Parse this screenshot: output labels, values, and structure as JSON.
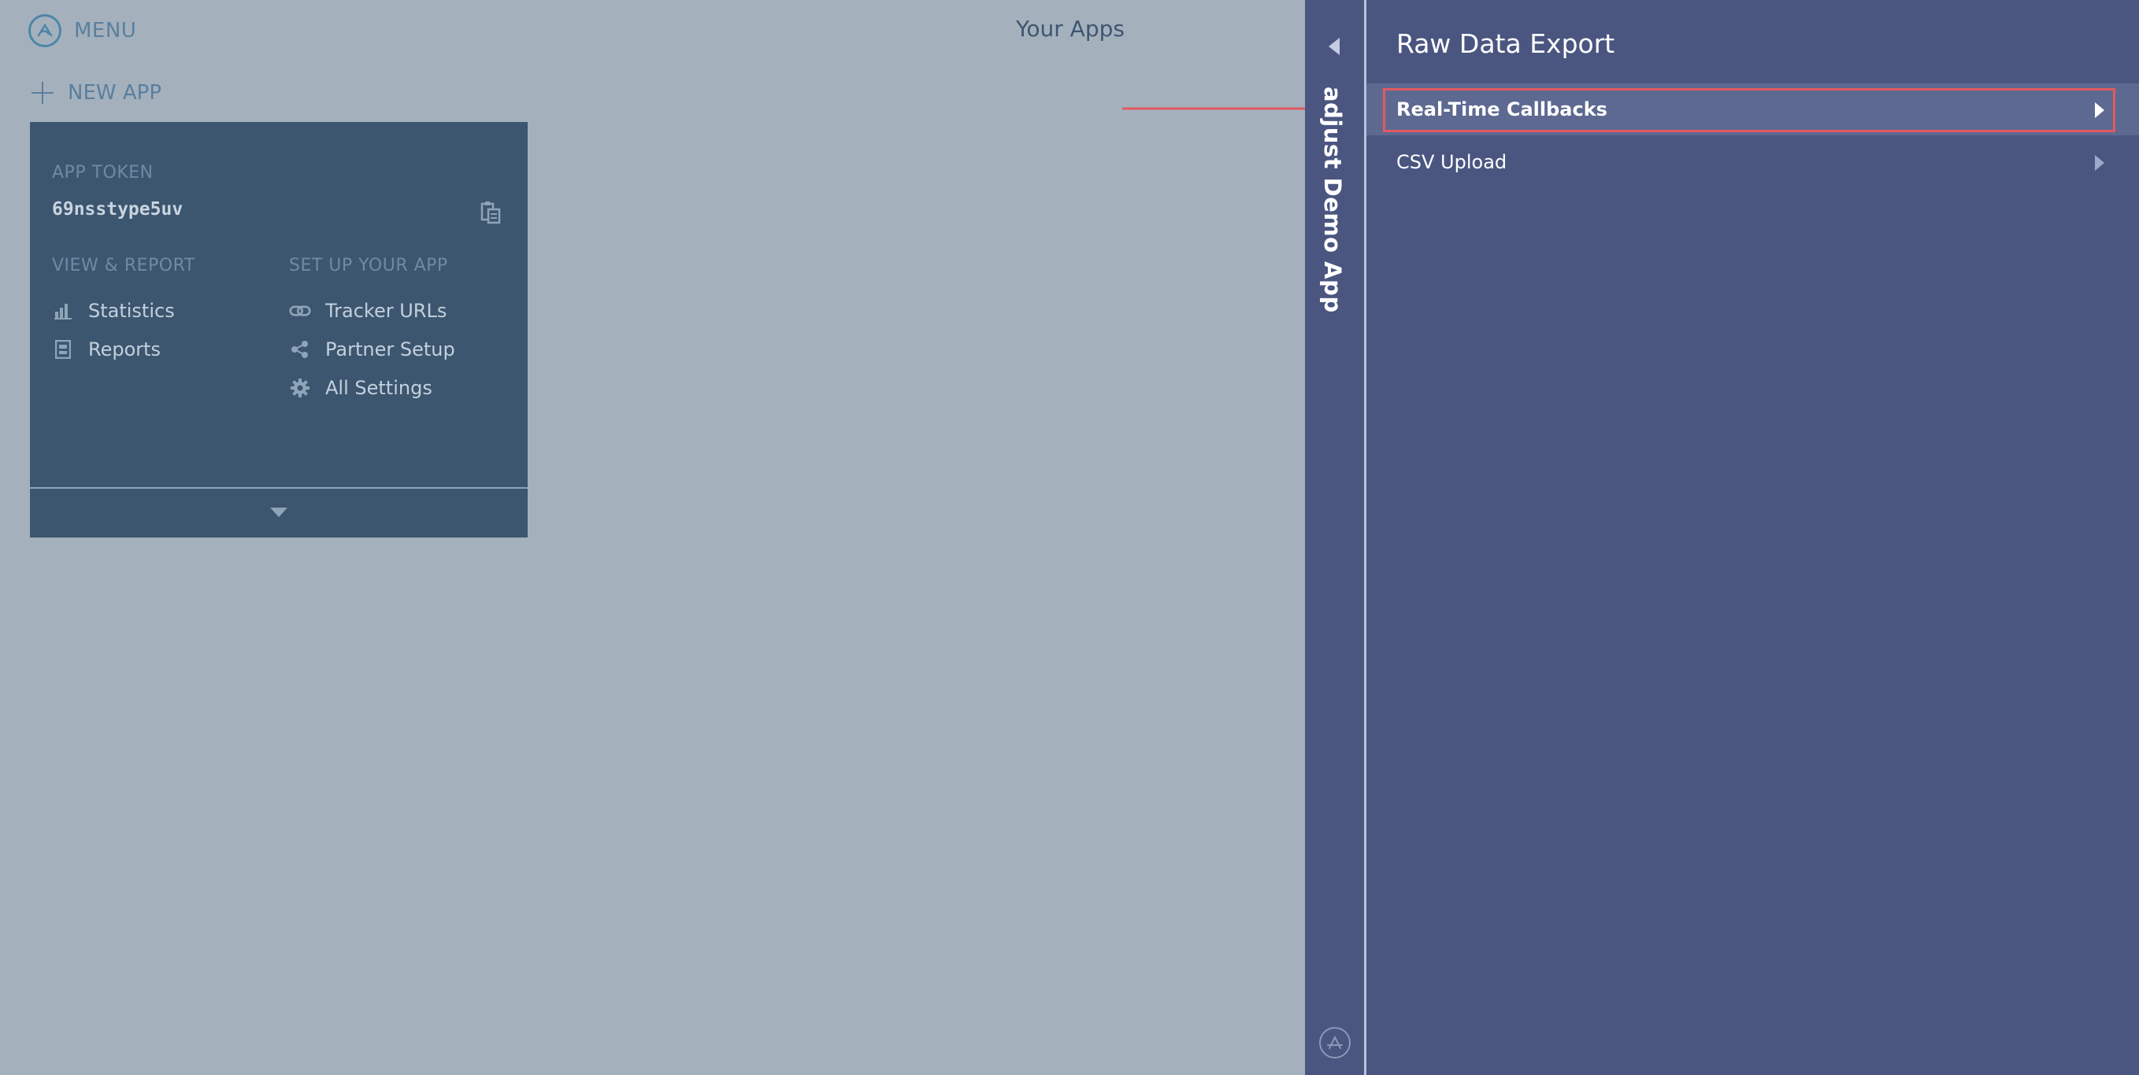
{
  "header": {
    "menu_label": "MENU",
    "page_title": "Your Apps"
  },
  "new_app": {
    "label": "NEW APP"
  },
  "app_card": {
    "token_label": "APP TOKEN",
    "token_value": "69nsstype5uv",
    "view_report": {
      "heading": "VIEW & REPORT",
      "items": [
        {
          "label": "Statistics",
          "icon": "bar-chart-icon"
        },
        {
          "label": "Reports",
          "icon": "report-icon"
        }
      ]
    },
    "setup": {
      "heading": "SET UP YOUR APP",
      "items": [
        {
          "label": "Tracker URLs",
          "icon": "link-icon"
        },
        {
          "label": "Partner Setup",
          "icon": "share-icon"
        },
        {
          "label": "All Settings",
          "icon": "gear-icon"
        }
      ]
    }
  },
  "side_panel": {
    "app_name": "adjust Demo App",
    "title": "Raw Data Export",
    "items": [
      {
        "label": "Real-Time Callbacks",
        "active": true
      },
      {
        "label": "CSV Upload",
        "active": false
      }
    ]
  },
  "colors": {
    "page_background": "#a4b1bd",
    "card_background": "#3d566f",
    "panel_background": "#4a5680",
    "active_row": "#5d6991",
    "annotation_red": "#e25a5f"
  }
}
